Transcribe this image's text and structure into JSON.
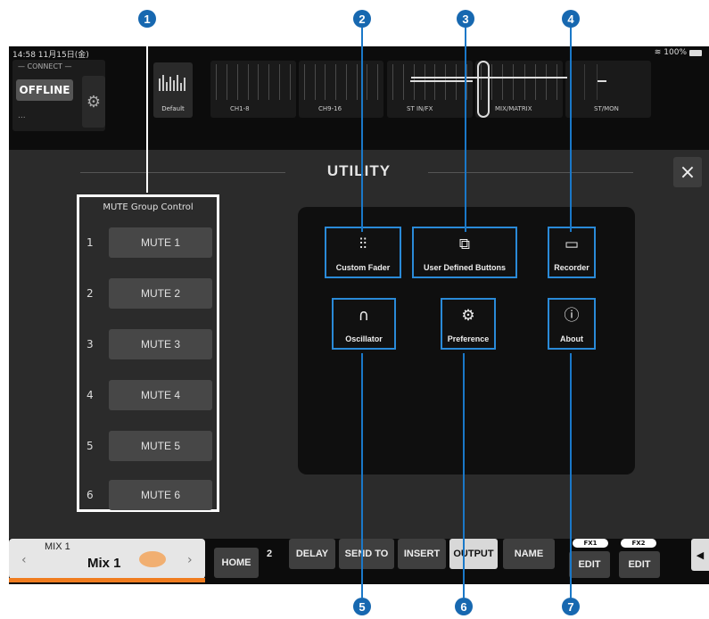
{
  "callouts": [
    "1",
    "2",
    "3",
    "4",
    "5",
    "6",
    "7"
  ],
  "status": {
    "time": "14:58  11月15日(金)",
    "battery": "100%",
    "wifi_icon": "wifi-icon"
  },
  "connect": {
    "label": "— CONNECT —",
    "offline": "OFFLINE",
    "dots": "..."
  },
  "default_label": "Default",
  "banks": [
    "CH1-8",
    "CH9-16",
    "ST IN/FX",
    "MIX/MATRIX",
    "ST/MON"
  ],
  "utility_title": "UTILITY",
  "close_symbol": "×",
  "mute_group": {
    "title": "MUTE Group Control",
    "rows": [
      {
        "num": "1",
        "label": "MUTE 1"
      },
      {
        "num": "2",
        "label": "MUTE 2"
      },
      {
        "num": "3",
        "label": "MUTE 3"
      },
      {
        "num": "4",
        "label": "MUTE 4"
      },
      {
        "num": "5",
        "label": "MUTE 5"
      },
      {
        "num": "6",
        "label": "MUTE 6"
      }
    ]
  },
  "utility_buttons": {
    "custom_fader": {
      "label": "Custom Fader",
      "icon": "sliders-icon"
    },
    "user_defined": {
      "label": "User Defined Buttons",
      "icon": "user-button-icon"
    },
    "recorder": {
      "label": "Recorder",
      "icon": "cassette-icon"
    },
    "oscillator": {
      "label": "Oscillator",
      "icon": "headphones-icon"
    },
    "preference": {
      "label": "Preference",
      "icon": "person-gear-icon"
    },
    "about": {
      "label": "About",
      "icon": "info-icon"
    }
  },
  "bottom": {
    "mix_top": "MIX 1",
    "mix_name": "Mix 1",
    "home": "HOME",
    "num2": "2",
    "delay": "DELAY",
    "send_to": "SEND TO",
    "insert": "INSERT",
    "output": "OUTPUT",
    "name": "NAME",
    "fx1": "FX1",
    "fx2": "FX2",
    "edit": "EDIT"
  },
  "colors": {
    "accent_blue": "#1768b0",
    "mix_stripe": "#f07c1f",
    "highlight_border": "#2a8ad8"
  }
}
